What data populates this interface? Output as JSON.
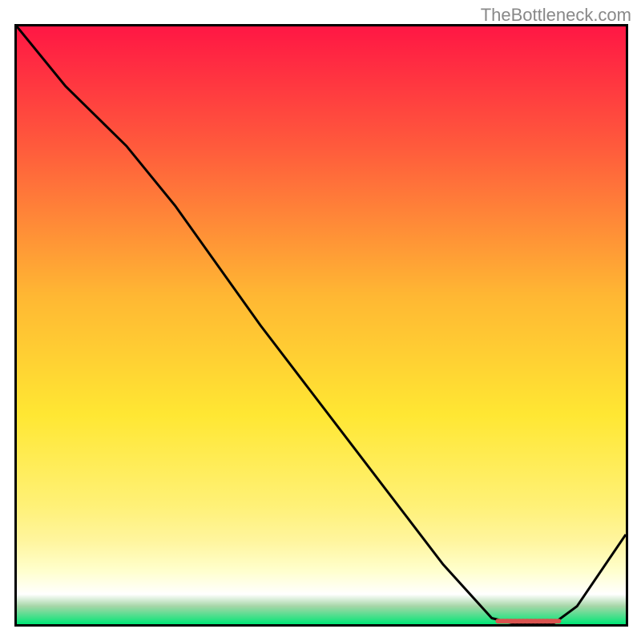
{
  "watermark": "TheBottleneck.com",
  "chart_data": {
    "type": "line",
    "title": "",
    "xlabel": "",
    "ylabel": "",
    "xlim": [
      0,
      100
    ],
    "ylim": [
      0,
      100
    ],
    "grid": false,
    "legend": false,
    "gradient_stops": [
      {
        "offset": 0,
        "color": "#ff1744"
      },
      {
        "offset": 20,
        "color": "#ff5a3c"
      },
      {
        "offset": 45,
        "color": "#ffb733"
      },
      {
        "offset": 65,
        "color": "#ffe733"
      },
      {
        "offset": 80,
        "color": "#fff176"
      },
      {
        "offset": 86,
        "color": "#fff59d"
      },
      {
        "offset": 91,
        "color": "#ffffcc"
      },
      {
        "offset": 95,
        "color": "#ffffff"
      },
      {
        "offset": 97,
        "color": "#a5d6a7"
      },
      {
        "offset": 100,
        "color": "#00e676"
      }
    ],
    "series": [
      {
        "name": "curve",
        "color": "#000000",
        "x": [
          0,
          8,
          18,
          26,
          40,
          55,
          70,
          78,
          82,
          88,
          92,
          100
        ],
        "y": [
          100,
          90,
          80,
          70,
          50,
          30,
          10,
          1,
          0,
          0,
          3,
          15
        ]
      }
    ],
    "marker": {
      "name": "highlight-bar",
      "color": "#d9534f",
      "x_start": 79,
      "x_end": 89,
      "y": 0.5
    }
  }
}
